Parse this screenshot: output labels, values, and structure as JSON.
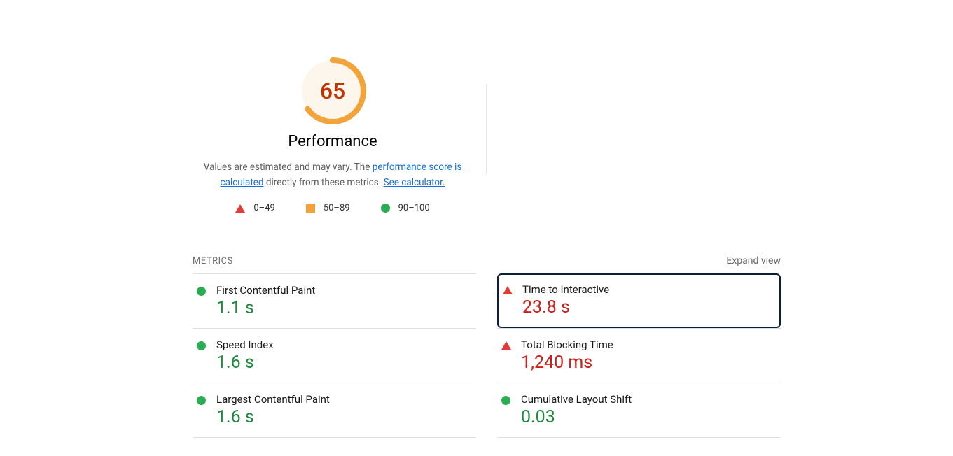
{
  "header": {
    "score": "65",
    "title": "Performance",
    "desc_prefix": "Values are estimated and may vary. The ",
    "link1": "performance score is calculated",
    "desc_mid": " directly from these metrics. ",
    "link2": "See calculator."
  },
  "legend": {
    "fail": "0–49",
    "avg": "50–89",
    "pass": "90–100"
  },
  "metrics_header": {
    "title": "METRICS",
    "expand": "Expand view"
  },
  "metrics": {
    "fcp": {
      "label": "First Contentful Paint",
      "value": "1.1 s"
    },
    "tti": {
      "label": "Time to Interactive",
      "value": "23.8 s"
    },
    "si": {
      "label": "Speed Index",
      "value": "1.6 s"
    },
    "tbt": {
      "label": "Total Blocking Time",
      "value": "1,240 ms"
    },
    "lcp": {
      "label": "Largest Contentful Paint",
      "value": "1.6 s"
    },
    "cls": {
      "label": "Cumulative Layout Shift",
      "value": "0.03"
    }
  },
  "colors": {
    "pass": "#2bab52",
    "avg": "#f2a43a",
    "fail": "#e53935"
  }
}
